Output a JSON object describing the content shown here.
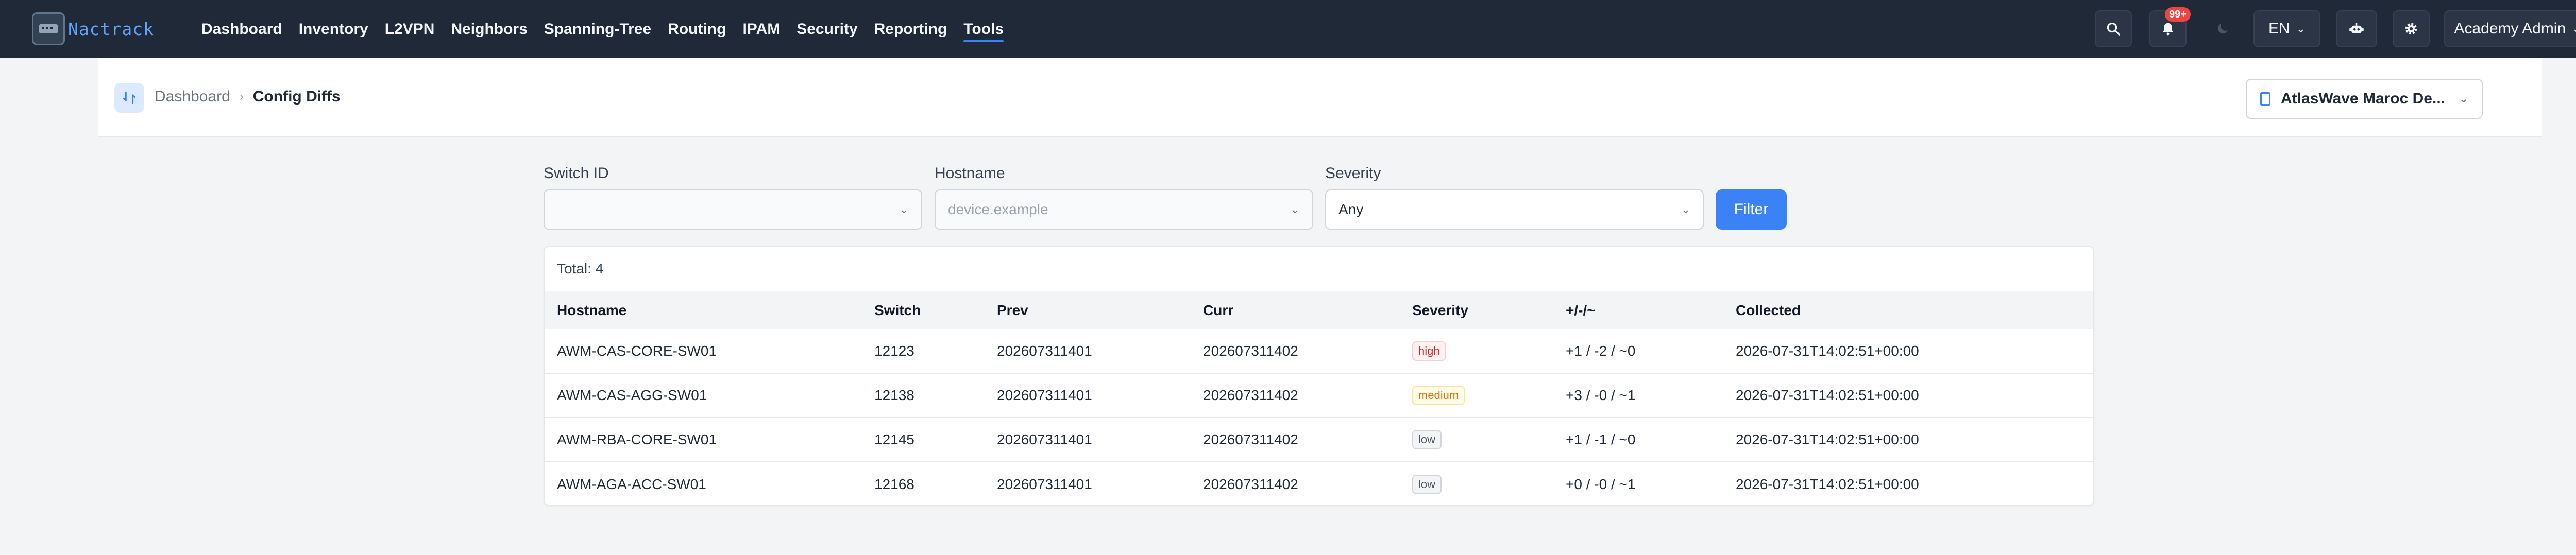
{
  "brand": {
    "name": "Nactrack"
  },
  "nav": {
    "links": [
      "Dashboard",
      "Inventory",
      "L2VPN",
      "Neighbors",
      "Spanning-Tree",
      "Routing",
      "IPAM",
      "Security",
      "Reporting",
      "Tools"
    ],
    "active": "Tools",
    "notification_count": "99+",
    "language": "EN",
    "user": "Academy Admin"
  },
  "breadcrumb": {
    "parent": "Dashboard",
    "current": "Config Diffs"
  },
  "site": {
    "selected": "AtlasWave Maroc De..."
  },
  "filters": {
    "switch_id": {
      "label": "Switch ID",
      "value": ""
    },
    "hostname": {
      "label": "Hostname",
      "placeholder": "device.example"
    },
    "severity": {
      "label": "Severity",
      "value": "Any"
    },
    "button": "Filter"
  },
  "table": {
    "total": "Total: 4",
    "columns": [
      "Hostname",
      "Switch",
      "Prev",
      "Curr",
      "Severity",
      "+/-/~",
      "Collected"
    ],
    "rows": [
      {
        "hostname": "AWM-CAS-CORE-SW01",
        "switch": "12123",
        "prev": "202607311401",
        "curr": "202607311402",
        "severity": "high",
        "diff": "+1 / -2 / ~0",
        "collected": "2026-07-31T14:02:51+00:00"
      },
      {
        "hostname": "AWM-CAS-AGG-SW01",
        "switch": "12138",
        "prev": "202607311401",
        "curr": "202607311402",
        "severity": "medium",
        "diff": "+3 / -0 / ~1",
        "collected": "2026-07-31T14:02:51+00:00"
      },
      {
        "hostname": "AWM-RBA-CORE-SW01",
        "switch": "12145",
        "prev": "202607311401",
        "curr": "202607311402",
        "severity": "low",
        "diff": "+1 / -1 / ~0",
        "collected": "2026-07-31T14:02:51+00:00"
      },
      {
        "hostname": "AWM-AGA-ACC-SW01",
        "switch": "12168",
        "prev": "202607311401",
        "curr": "202607311402",
        "severity": "low",
        "diff": "+0 / -0 / ~1",
        "collected": "2026-07-31T14:02:51+00:00"
      }
    ]
  },
  "severity_colors": {
    "high": {
      "fg": "#dc2626",
      "bg": "#fef2f2",
      "border": "#fecaca"
    },
    "medium": {
      "fg": "#d97706",
      "bg": "#fffbeb",
      "border": "#fde68a"
    },
    "low": {
      "fg": "#4b5563",
      "bg": "#f3f4f6",
      "border": "#d1d5db"
    }
  },
  "icons": [
    "app-logo-icon",
    "search-icon",
    "bell-icon",
    "moon-icon",
    "robot-icon",
    "gear-icon",
    "chevron-down-icon",
    "sync-icon",
    "building-icon"
  ]
}
